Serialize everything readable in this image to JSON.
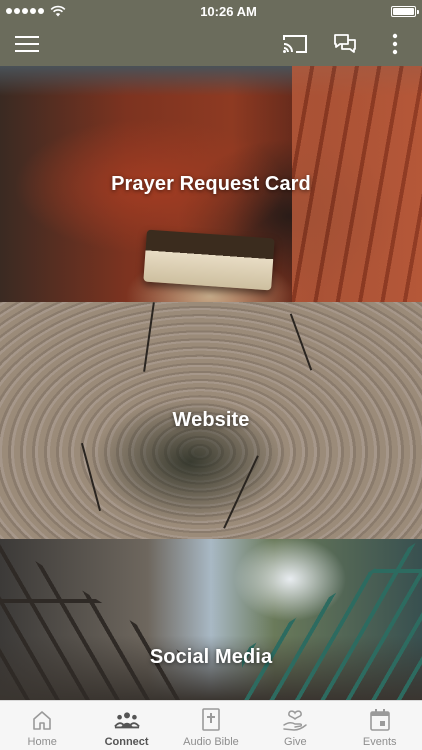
{
  "status_bar": {
    "time": "10:26 AM",
    "signal_dots": 5,
    "battery_level": 1.0
  },
  "nav": {
    "menu_icon": "hamburger-menu-icon",
    "cast_icon": "cast-icon",
    "chat_icon": "chat-bubbles-icon",
    "more_icon": "more-vertical-icon"
  },
  "tiles": [
    {
      "label": "Prayer Request Card"
    },
    {
      "label": "Website"
    },
    {
      "label": "Social Media"
    }
  ],
  "tabs": [
    {
      "label": "Home",
      "icon": "home-icon",
      "active": false
    },
    {
      "label": "Connect",
      "icon": "people-icon",
      "active": true
    },
    {
      "label": "Audio Bible",
      "icon": "bible-icon",
      "active": false
    },
    {
      "label": "Give",
      "icon": "give-heart-hand-icon",
      "active": false
    },
    {
      "label": "Events",
      "icon": "calendar-icon",
      "active": false
    }
  ],
  "colors": {
    "header": "#6b6c5c",
    "tab_active": "#555555",
    "tab_inactive": "#8e8e8e"
  }
}
